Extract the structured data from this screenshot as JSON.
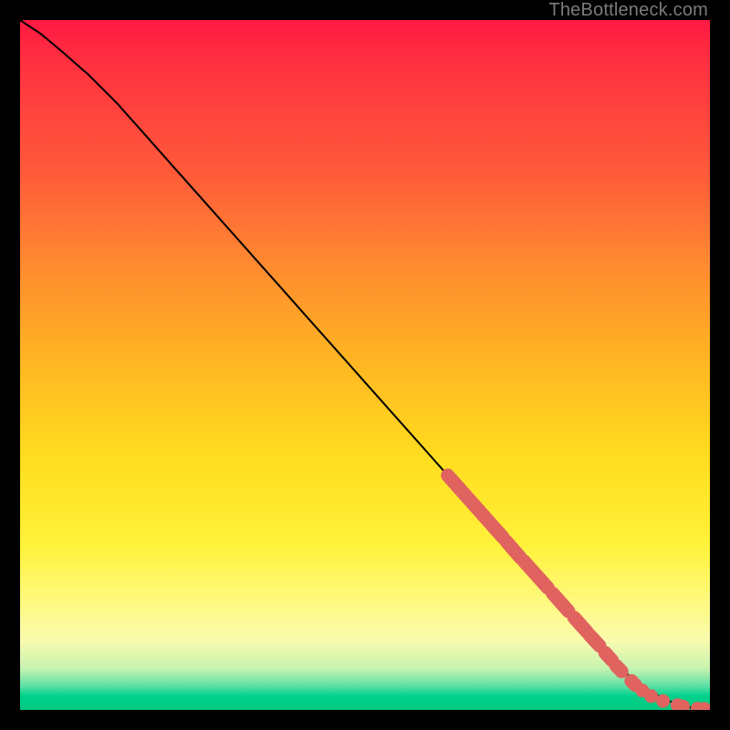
{
  "watermark": "TheBottleneck.com",
  "chart_data": {
    "type": "line",
    "title": "",
    "xlabel": "",
    "ylabel": "",
    "xlim": [
      0,
      100
    ],
    "ylim": [
      0,
      100
    ],
    "line": {
      "x": [
        0,
        3,
        6,
        10,
        14,
        18,
        22,
        26,
        30,
        34,
        38,
        42,
        46,
        50,
        54,
        58,
        62,
        66,
        70,
        74,
        78,
        82,
        86,
        88,
        90,
        92,
        94,
        96,
        98,
        100
      ],
      "y": [
        100,
        98,
        95.5,
        92,
        88,
        83.5,
        79,
        74.5,
        70,
        65.5,
        61,
        56.5,
        52,
        47.5,
        43,
        38.5,
        34,
        29.5,
        25,
        20.5,
        16,
        11.5,
        7,
        5.2,
        3.6,
        2.3,
        1.3,
        0.6,
        0.2,
        0.1
      ]
    },
    "marker_segments": [
      {
        "x0": 62,
        "y0": 34,
        "x1": 70,
        "y1": 25
      },
      {
        "x0": 70.5,
        "y0": 24.4,
        "x1": 72.5,
        "y1": 22.1
      },
      {
        "x0": 73,
        "y0": 21.6,
        "x1": 76.5,
        "y1": 17.7
      },
      {
        "x0": 77.2,
        "y0": 16.9,
        "x1": 79.5,
        "y1": 14.3
      },
      {
        "x0": 80.3,
        "y0": 13.4,
        "x1": 82.2,
        "y1": 11.3
      },
      {
        "x0": 82.6,
        "y0": 10.8,
        "x1": 84.0,
        "y1": 9.3
      },
      {
        "x0": 84.8,
        "y0": 8.3,
        "x1": 85.8,
        "y1": 7.2
      },
      {
        "x0": 86.4,
        "y0": 6.4,
        "x1": 87.2,
        "y1": 5.6
      },
      {
        "x0": 88.6,
        "y0": 4.2,
        "x1": 89.2,
        "y1": 3.6
      }
    ],
    "marker_dots": [
      {
        "x": 90.2,
        "y": 2.8
      },
      {
        "x": 91.5,
        "y": 2.0
      },
      {
        "x": 93.2,
        "y": 1.3
      },
      {
        "x": 95.3,
        "y": 0.7
      },
      {
        "x": 96.1,
        "y": 0.5
      },
      {
        "x": 98.2,
        "y": 0.2
      },
      {
        "x": 99.2,
        "y": 0.15
      }
    ],
    "marker_color": "#e0635f",
    "line_color": "#000000"
  }
}
